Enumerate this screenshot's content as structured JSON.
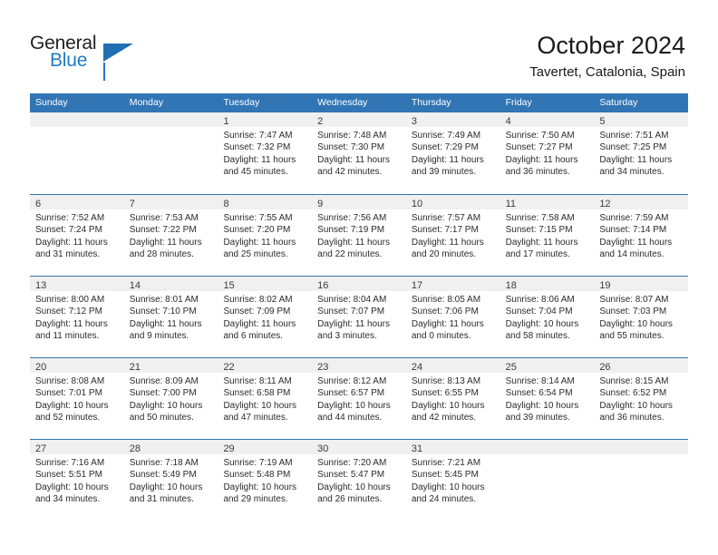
{
  "brand": {
    "name_top": "General",
    "name_bottom": "Blue",
    "triangle_color": "#1f6fb2",
    "blue_color": "#1f7ac4"
  },
  "header": {
    "title": "October 2024",
    "subtitle": "Tavertet, Catalonia, Spain"
  },
  "theme": {
    "header_blue": "#3175b4",
    "day_band_gray": "#f0f0f0"
  },
  "weekdays": [
    "Sunday",
    "Monday",
    "Tuesday",
    "Wednesday",
    "Thursday",
    "Friday",
    "Saturday"
  ],
  "weeks": [
    [
      {
        "day": "",
        "empty": true
      },
      {
        "day": "",
        "empty": true
      },
      {
        "day": "1",
        "sunrise": "Sunrise: 7:47 AM",
        "sunset": "Sunset: 7:32 PM",
        "daylight1": "Daylight: 11 hours",
        "daylight2": "and 45 minutes."
      },
      {
        "day": "2",
        "sunrise": "Sunrise: 7:48 AM",
        "sunset": "Sunset: 7:30 PM",
        "daylight1": "Daylight: 11 hours",
        "daylight2": "and 42 minutes."
      },
      {
        "day": "3",
        "sunrise": "Sunrise: 7:49 AM",
        "sunset": "Sunset: 7:29 PM",
        "daylight1": "Daylight: 11 hours",
        "daylight2": "and 39 minutes."
      },
      {
        "day": "4",
        "sunrise": "Sunrise: 7:50 AM",
        "sunset": "Sunset: 7:27 PM",
        "daylight1": "Daylight: 11 hours",
        "daylight2": "and 36 minutes."
      },
      {
        "day": "5",
        "sunrise": "Sunrise: 7:51 AM",
        "sunset": "Sunset: 7:25 PM",
        "daylight1": "Daylight: 11 hours",
        "daylight2": "and 34 minutes."
      }
    ],
    [
      {
        "day": "6",
        "sunrise": "Sunrise: 7:52 AM",
        "sunset": "Sunset: 7:24 PM",
        "daylight1": "Daylight: 11 hours",
        "daylight2": "and 31 minutes."
      },
      {
        "day": "7",
        "sunrise": "Sunrise: 7:53 AM",
        "sunset": "Sunset: 7:22 PM",
        "daylight1": "Daylight: 11 hours",
        "daylight2": "and 28 minutes."
      },
      {
        "day": "8",
        "sunrise": "Sunrise: 7:55 AM",
        "sunset": "Sunset: 7:20 PM",
        "daylight1": "Daylight: 11 hours",
        "daylight2": "and 25 minutes."
      },
      {
        "day": "9",
        "sunrise": "Sunrise: 7:56 AM",
        "sunset": "Sunset: 7:19 PM",
        "daylight1": "Daylight: 11 hours",
        "daylight2": "and 22 minutes."
      },
      {
        "day": "10",
        "sunrise": "Sunrise: 7:57 AM",
        "sunset": "Sunset: 7:17 PM",
        "daylight1": "Daylight: 11 hours",
        "daylight2": "and 20 minutes."
      },
      {
        "day": "11",
        "sunrise": "Sunrise: 7:58 AM",
        "sunset": "Sunset: 7:15 PM",
        "daylight1": "Daylight: 11 hours",
        "daylight2": "and 17 minutes."
      },
      {
        "day": "12",
        "sunrise": "Sunrise: 7:59 AM",
        "sunset": "Sunset: 7:14 PM",
        "daylight1": "Daylight: 11 hours",
        "daylight2": "and 14 minutes."
      }
    ],
    [
      {
        "day": "13",
        "sunrise": "Sunrise: 8:00 AM",
        "sunset": "Sunset: 7:12 PM",
        "daylight1": "Daylight: 11 hours",
        "daylight2": "and 11 minutes."
      },
      {
        "day": "14",
        "sunrise": "Sunrise: 8:01 AM",
        "sunset": "Sunset: 7:10 PM",
        "daylight1": "Daylight: 11 hours",
        "daylight2": "and 9 minutes."
      },
      {
        "day": "15",
        "sunrise": "Sunrise: 8:02 AM",
        "sunset": "Sunset: 7:09 PM",
        "daylight1": "Daylight: 11 hours",
        "daylight2": "and 6 minutes."
      },
      {
        "day": "16",
        "sunrise": "Sunrise: 8:04 AM",
        "sunset": "Sunset: 7:07 PM",
        "daylight1": "Daylight: 11 hours",
        "daylight2": "and 3 minutes."
      },
      {
        "day": "17",
        "sunrise": "Sunrise: 8:05 AM",
        "sunset": "Sunset: 7:06 PM",
        "daylight1": "Daylight: 11 hours",
        "daylight2": "and 0 minutes."
      },
      {
        "day": "18",
        "sunrise": "Sunrise: 8:06 AM",
        "sunset": "Sunset: 7:04 PM",
        "daylight1": "Daylight: 10 hours",
        "daylight2": "and 58 minutes."
      },
      {
        "day": "19",
        "sunrise": "Sunrise: 8:07 AM",
        "sunset": "Sunset: 7:03 PM",
        "daylight1": "Daylight: 10 hours",
        "daylight2": "and 55 minutes."
      }
    ],
    [
      {
        "day": "20",
        "sunrise": "Sunrise: 8:08 AM",
        "sunset": "Sunset: 7:01 PM",
        "daylight1": "Daylight: 10 hours",
        "daylight2": "and 52 minutes."
      },
      {
        "day": "21",
        "sunrise": "Sunrise: 8:09 AM",
        "sunset": "Sunset: 7:00 PM",
        "daylight1": "Daylight: 10 hours",
        "daylight2": "and 50 minutes."
      },
      {
        "day": "22",
        "sunrise": "Sunrise: 8:11 AM",
        "sunset": "Sunset: 6:58 PM",
        "daylight1": "Daylight: 10 hours",
        "daylight2": "and 47 minutes."
      },
      {
        "day": "23",
        "sunrise": "Sunrise: 8:12 AM",
        "sunset": "Sunset: 6:57 PM",
        "daylight1": "Daylight: 10 hours",
        "daylight2": "and 44 minutes."
      },
      {
        "day": "24",
        "sunrise": "Sunrise: 8:13 AM",
        "sunset": "Sunset: 6:55 PM",
        "daylight1": "Daylight: 10 hours",
        "daylight2": "and 42 minutes."
      },
      {
        "day": "25",
        "sunrise": "Sunrise: 8:14 AM",
        "sunset": "Sunset: 6:54 PM",
        "daylight1": "Daylight: 10 hours",
        "daylight2": "and 39 minutes."
      },
      {
        "day": "26",
        "sunrise": "Sunrise: 8:15 AM",
        "sunset": "Sunset: 6:52 PM",
        "daylight1": "Daylight: 10 hours",
        "daylight2": "and 36 minutes."
      }
    ],
    [
      {
        "day": "27",
        "sunrise": "Sunrise: 7:16 AM",
        "sunset": "Sunset: 5:51 PM",
        "daylight1": "Daylight: 10 hours",
        "daylight2": "and 34 minutes."
      },
      {
        "day": "28",
        "sunrise": "Sunrise: 7:18 AM",
        "sunset": "Sunset: 5:49 PM",
        "daylight1": "Daylight: 10 hours",
        "daylight2": "and 31 minutes."
      },
      {
        "day": "29",
        "sunrise": "Sunrise: 7:19 AM",
        "sunset": "Sunset: 5:48 PM",
        "daylight1": "Daylight: 10 hours",
        "daylight2": "and 29 minutes."
      },
      {
        "day": "30",
        "sunrise": "Sunrise: 7:20 AM",
        "sunset": "Sunset: 5:47 PM",
        "daylight1": "Daylight: 10 hours",
        "daylight2": "and 26 minutes."
      },
      {
        "day": "31",
        "sunrise": "Sunrise: 7:21 AM",
        "sunset": "Sunset: 5:45 PM",
        "daylight1": "Daylight: 10 hours",
        "daylight2": "and 24 minutes."
      },
      {
        "day": "",
        "empty": true
      },
      {
        "day": "",
        "empty": true
      }
    ]
  ]
}
